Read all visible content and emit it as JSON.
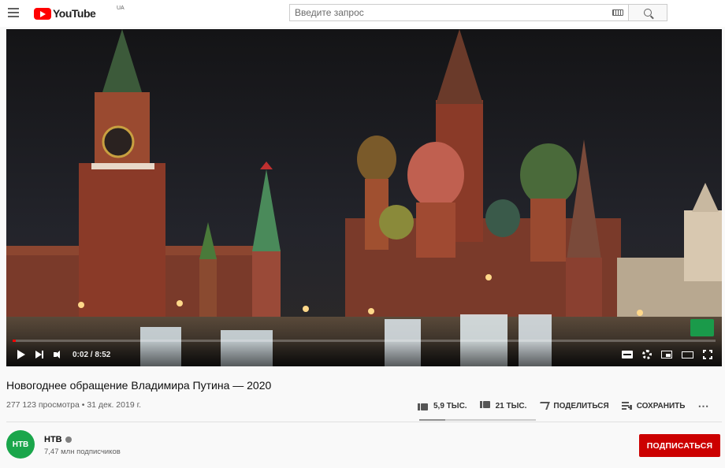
{
  "masthead": {
    "logo_text": "YouTube",
    "country_code": "UA",
    "search_placeholder": "Введите запрос"
  },
  "player": {
    "time_display": "0:02 / 8:52",
    "progress_played": 0.004,
    "colors": {
      "progress": "#ff0000"
    }
  },
  "video": {
    "title": "Новогоднее обращение Владимира Путина — 2020",
    "meta": "277 123 просмотра • 31 дек. 2019 г."
  },
  "actions": {
    "likes": "5,9 ТЫС.",
    "dislikes": "21 ТЫС.",
    "share_label": "ПОДЕЛИТЬСЯ",
    "save_label": "СОХРАНИТЬ",
    "more_label": "⋯",
    "like_ratio": 0.22
  },
  "channel": {
    "avatar_text": "НТВ",
    "name": "НТВ",
    "subscribers": "7,47 млн подписчиков",
    "subscribe_label": "ПОДПИСАТЬСЯ",
    "colors": {
      "avatar": "#1aa64b",
      "subscribe": "#cc0000"
    }
  }
}
